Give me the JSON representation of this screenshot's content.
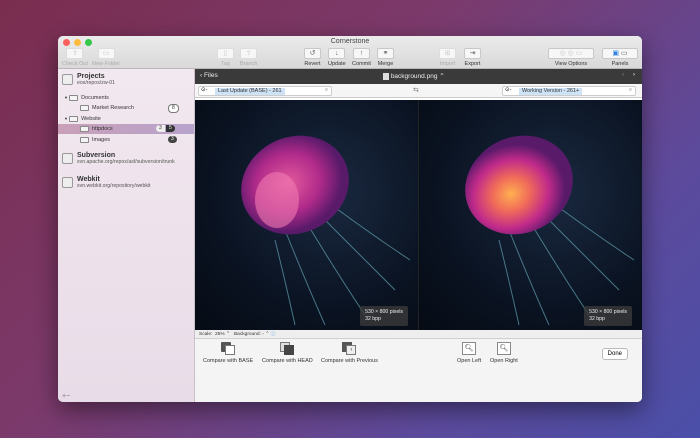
{
  "window": {
    "title": "Cornerstone"
  },
  "toolbar": [
    {
      "label": "Check Out",
      "icon": "checkout-icon",
      "disabled": true
    },
    {
      "label": "New Folder",
      "icon": "folder-icon",
      "disabled": true
    },
    {
      "label": "Tag",
      "icon": "tag-icon",
      "disabled": true
    },
    {
      "label": "Branch",
      "icon": "branch-icon",
      "disabled": true
    },
    {
      "label": "Revert",
      "icon": "revert-icon",
      "disabled": false
    },
    {
      "label": "Update",
      "icon": "update-icon",
      "disabled": false
    },
    {
      "label": "Commit",
      "icon": "commit-icon",
      "disabled": false
    },
    {
      "label": "Merge",
      "icon": "merge-icon",
      "disabled": false
    },
    {
      "label": "Import",
      "icon": "import-icon",
      "disabled": true
    },
    {
      "label": "Export",
      "icon": "export-icon",
      "disabled": false
    },
    {
      "label": "View Options",
      "icon": "view-options-icon",
      "disabled": false
    },
    {
      "label": "Panels",
      "icon": "panels-icon",
      "disabled": false
    }
  ],
  "sidebar": {
    "projects": {
      "name": "Projects",
      "path": "eos/repos/zw-01"
    },
    "items": [
      {
        "label": "Documents"
      },
      {
        "label": "Market Research",
        "badge": "8"
      },
      {
        "label": "Website"
      },
      {
        "label": "httpdocs",
        "badge1": "3",
        "badge2": "5"
      },
      {
        "label": "Images",
        "badge": "3"
      }
    ],
    "subversion": {
      "name": "Subversion",
      "path": "svn.apache.org/repos/asf/subversion/trunk"
    },
    "webkit": {
      "name": "Webkit",
      "path": "svn.webkit.org/repository/webkit"
    },
    "add": "+",
    "remove": "−"
  },
  "nav": {
    "back": "Files",
    "file": "background.png ⌃"
  },
  "compare": {
    "left": "Last Update (BASE) - 261",
    "right": "Working Version - 261+",
    "swap": "⇆"
  },
  "panes": [
    {
      "size": "530 × 800 pixels",
      "bpp": "32 bpp"
    },
    {
      "size": "530 × 800 pixels",
      "bpp": "32 bpp"
    }
  ],
  "scalebar": {
    "scale_label": "Scale:",
    "scale": "25%",
    "bg_label": "Background:"
  },
  "bottom": {
    "compare_base": "Compare with BASE",
    "compare_head": "Compare with HEAD",
    "compare_prev": "Compare with Previous",
    "open_left": "Open Left",
    "open_right": "Open Right",
    "done": "Done"
  }
}
